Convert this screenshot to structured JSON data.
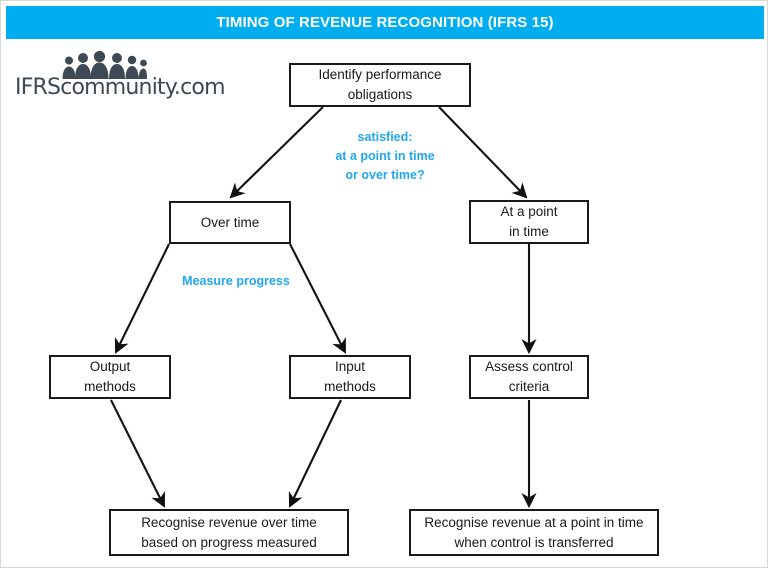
{
  "header": {
    "title": "TIMING OF REVENUE RECOGNITION (IFRS 15)",
    "background_color": "#00ADEF",
    "text_color": "#FFFFFF"
  },
  "logo": {
    "wordmark": "IFRScommunity.com",
    "icon_name": "people-group-icon",
    "color": "#3D4A55"
  },
  "diagram": {
    "type": "flowchart",
    "accent_color": "#22A7F0",
    "node_border_color": "#1A1A1A",
    "nodes": [
      {
        "id": "identify",
        "label_line1": "Identify performance",
        "label_line2": "obligations"
      },
      {
        "id": "over_time",
        "label_line1": "Over time",
        "label_line2": ""
      },
      {
        "id": "point_in_time",
        "label_line1": "At a point",
        "label_line2": "in time"
      },
      {
        "id": "output_methods",
        "label_line1": "Output",
        "label_line2": "methods"
      },
      {
        "id": "input_methods",
        "label_line1": "Input",
        "label_line2": "methods"
      },
      {
        "id": "assess_control",
        "label_line1": "Assess control",
        "label_line2": "criteria"
      },
      {
        "id": "recognise_over_time",
        "label_line1": "Recognise revenue over time",
        "label_line2": "based on progress measured"
      },
      {
        "id": "recognise_point_in_time",
        "label_line1": "Recognise revenue at a point in time",
        "label_line2": "when control is transferred"
      }
    ],
    "edge_labels": [
      {
        "id": "satisfied",
        "line1": "satisfied:",
        "line2": "at a point in time",
        "line3": "or over time?"
      },
      {
        "id": "measure_progress",
        "line1": "Measure progress"
      }
    ]
  }
}
